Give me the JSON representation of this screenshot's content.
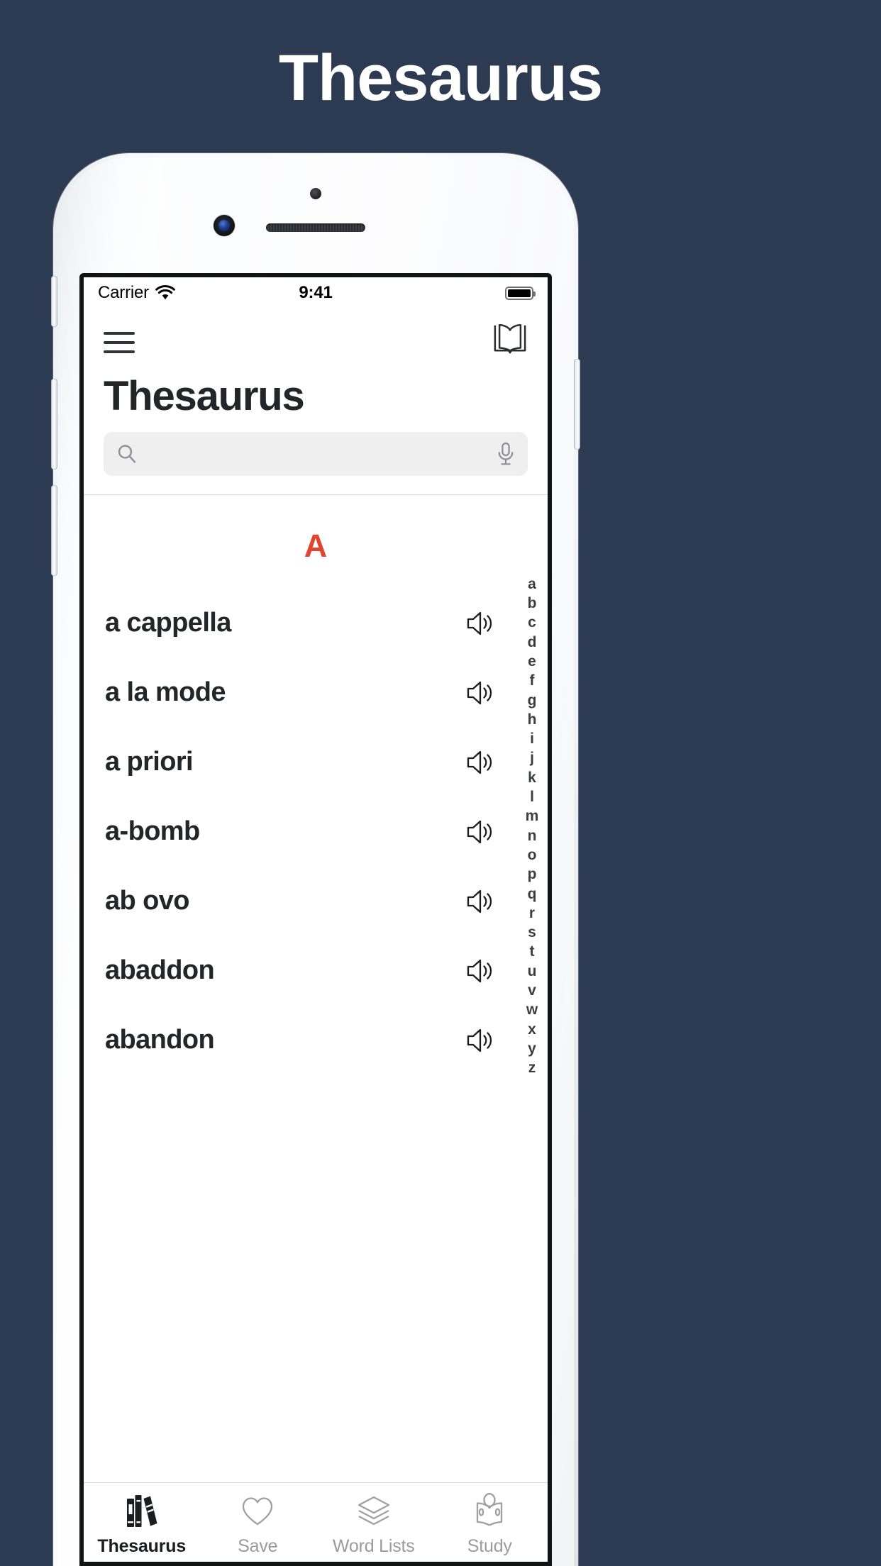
{
  "headline": "Thesaurus",
  "device": {
    "status_bar": {
      "carrier": "Carrier",
      "time": "9:41",
      "wifi_icon": "wifi-icon",
      "battery_icon": "battery-full-icon"
    },
    "navbar": {
      "menu_icon": "hamburger-menu-icon",
      "book_icon": "open-book-icon"
    },
    "app_title": "Thesaurus",
    "search": {
      "placeholder": "",
      "value": "",
      "search_icon": "search-icon",
      "mic_icon": "microphone-icon"
    },
    "list": {
      "section_letter": "A",
      "section_letter_color": "#e0452f",
      "speaker_icon": "speaker-icon",
      "words": [
        "a cappella",
        "a la mode",
        "a priori",
        "a-bomb",
        "ab ovo",
        "abaddon",
        "abandon"
      ]
    },
    "alphabet_index": [
      "a",
      "b",
      "c",
      "d",
      "e",
      "f",
      "g",
      "h",
      "i",
      "j",
      "k",
      "l",
      "m",
      "n",
      "o",
      "p",
      "q",
      "r",
      "s",
      "t",
      "u",
      "v",
      "w",
      "x",
      "y",
      "z"
    ],
    "tabs": [
      {
        "label": "Thesaurus",
        "icon": "books-icon",
        "active": true
      },
      {
        "label": "Save",
        "icon": "heart-icon",
        "active": false
      },
      {
        "label": "Word Lists",
        "icon": "layers-icon",
        "active": false
      },
      {
        "label": "Study",
        "icon": "person-reading-icon",
        "active": false
      }
    ]
  },
  "colors": {
    "background": "#2d3b52",
    "accent": "#e0452f",
    "text_dark": "#232528",
    "text_muted": "#9b9b9e",
    "search_field": "#efeff0"
  }
}
